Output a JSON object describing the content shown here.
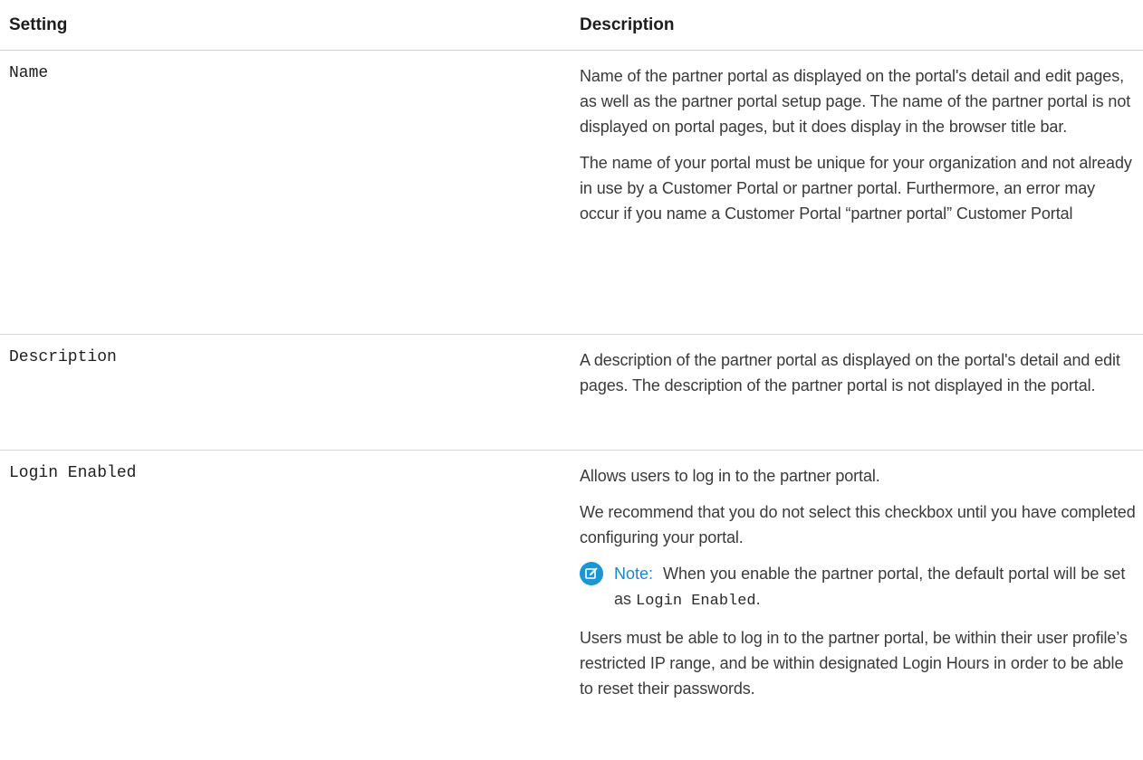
{
  "header": {
    "setting": "Setting",
    "description": "Description"
  },
  "rows": [
    {
      "setting": "Name",
      "paragraphs": [
        "Name of the partner portal as displayed on the portal's detail and edit pages, as well as the partner portal setup page. The name of the partner portal is not displayed on portal pages, but it does display in the browser title bar.",
        "The name of your portal must be unique for your organization and not already in use by a Customer Portal or partner portal. Furthermore, an error may occur if you name a Customer Portal “partner portal” Customer Portal"
      ]
    },
    {
      "setting": "Description",
      "paragraphs": [
        "A description of the partner portal as displayed on the portal's detail and edit pages. The description of the partner portal is not displayed in the portal."
      ]
    },
    {
      "setting": "Login Enabled",
      "paragraphs": [
        "Allows users to log in to the partner portal.",
        "We recommend that you do not select this checkbox until you have completed configuring your portal."
      ],
      "note": {
        "icon": "edit-note-icon",
        "label": "Note:",
        "text_before": "When you enable the partner portal, the default portal will be set as",
        "code": "Login Enabled",
        "text_after": "."
      },
      "paragraphs_after": [
        "Users must be able to log in to the partner portal, be within their user profile’s restricted IP range, and be within designated Login Hours in order to be able to reset their passwords."
      ]
    }
  ],
  "colors": {
    "note_accent": "#1b96d4",
    "note_label": "#1b89c9",
    "divider": "#d9d9d9"
  }
}
